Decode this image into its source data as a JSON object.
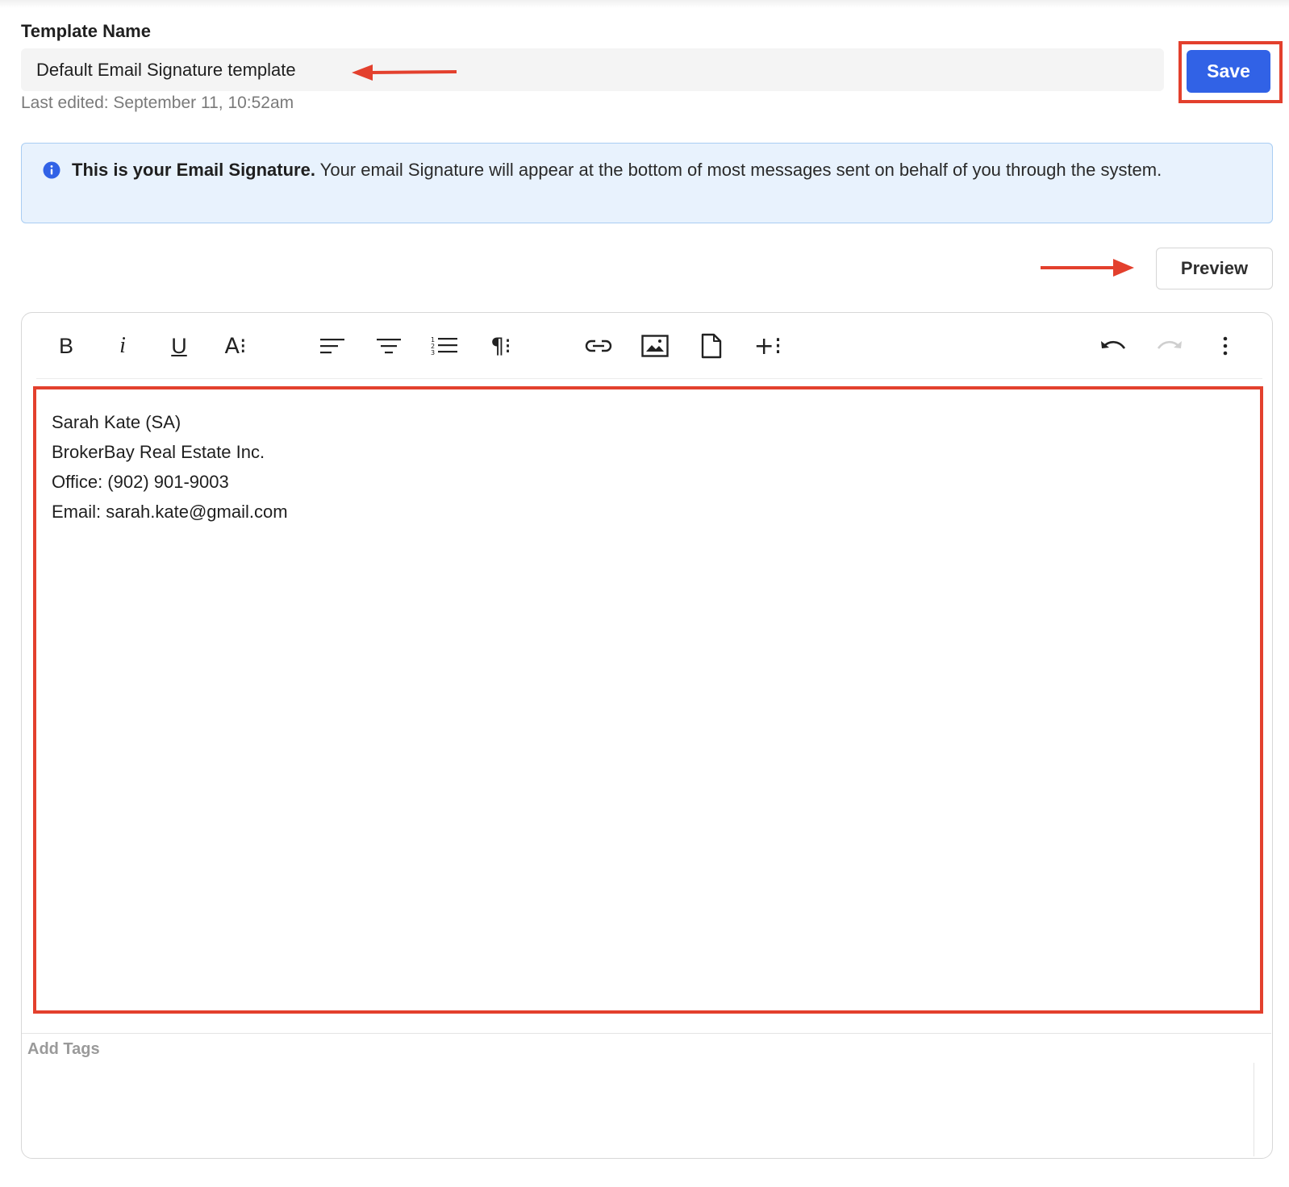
{
  "form": {
    "template_name_label": "Template Name",
    "template_name_value": "Default Email Signature template",
    "last_edited": "Last edited: September 11, 10:52am",
    "save_label": "Save",
    "preview_label": "Preview"
  },
  "info": {
    "bold_text": "This is your Email Signature.",
    "body_text": " Your email Signature will appear at the bottom of most messages sent on behalf of you through the system."
  },
  "toolbar": {
    "items": [
      {
        "name": "bold",
        "glyph": "B"
      },
      {
        "name": "italic",
        "glyph": "i"
      },
      {
        "name": "underline",
        "glyph": "U"
      },
      {
        "name": "font-size",
        "glyph": "A⁝"
      },
      {
        "name": "align-left"
      },
      {
        "name": "align-center"
      },
      {
        "name": "ordered-list"
      },
      {
        "name": "paragraph",
        "glyph": "¶⁝"
      },
      {
        "name": "link"
      },
      {
        "name": "image"
      },
      {
        "name": "file"
      },
      {
        "name": "insert-more",
        "glyph": "+⁝"
      },
      {
        "name": "undo"
      },
      {
        "name": "redo"
      },
      {
        "name": "more-vertical"
      }
    ]
  },
  "editor": {
    "lines": [
      "Sarah Kate (SA)",
      "BrokerBay Real Estate Inc.",
      "Office: (902) 901-9003",
      "Email: sarah.kate@gmail.com"
    ]
  },
  "tags": {
    "label": "Add Tags"
  },
  "colors": {
    "accent": "#3162e6",
    "info_bg": "#e8f2fd",
    "annotation": "#e3402d"
  }
}
